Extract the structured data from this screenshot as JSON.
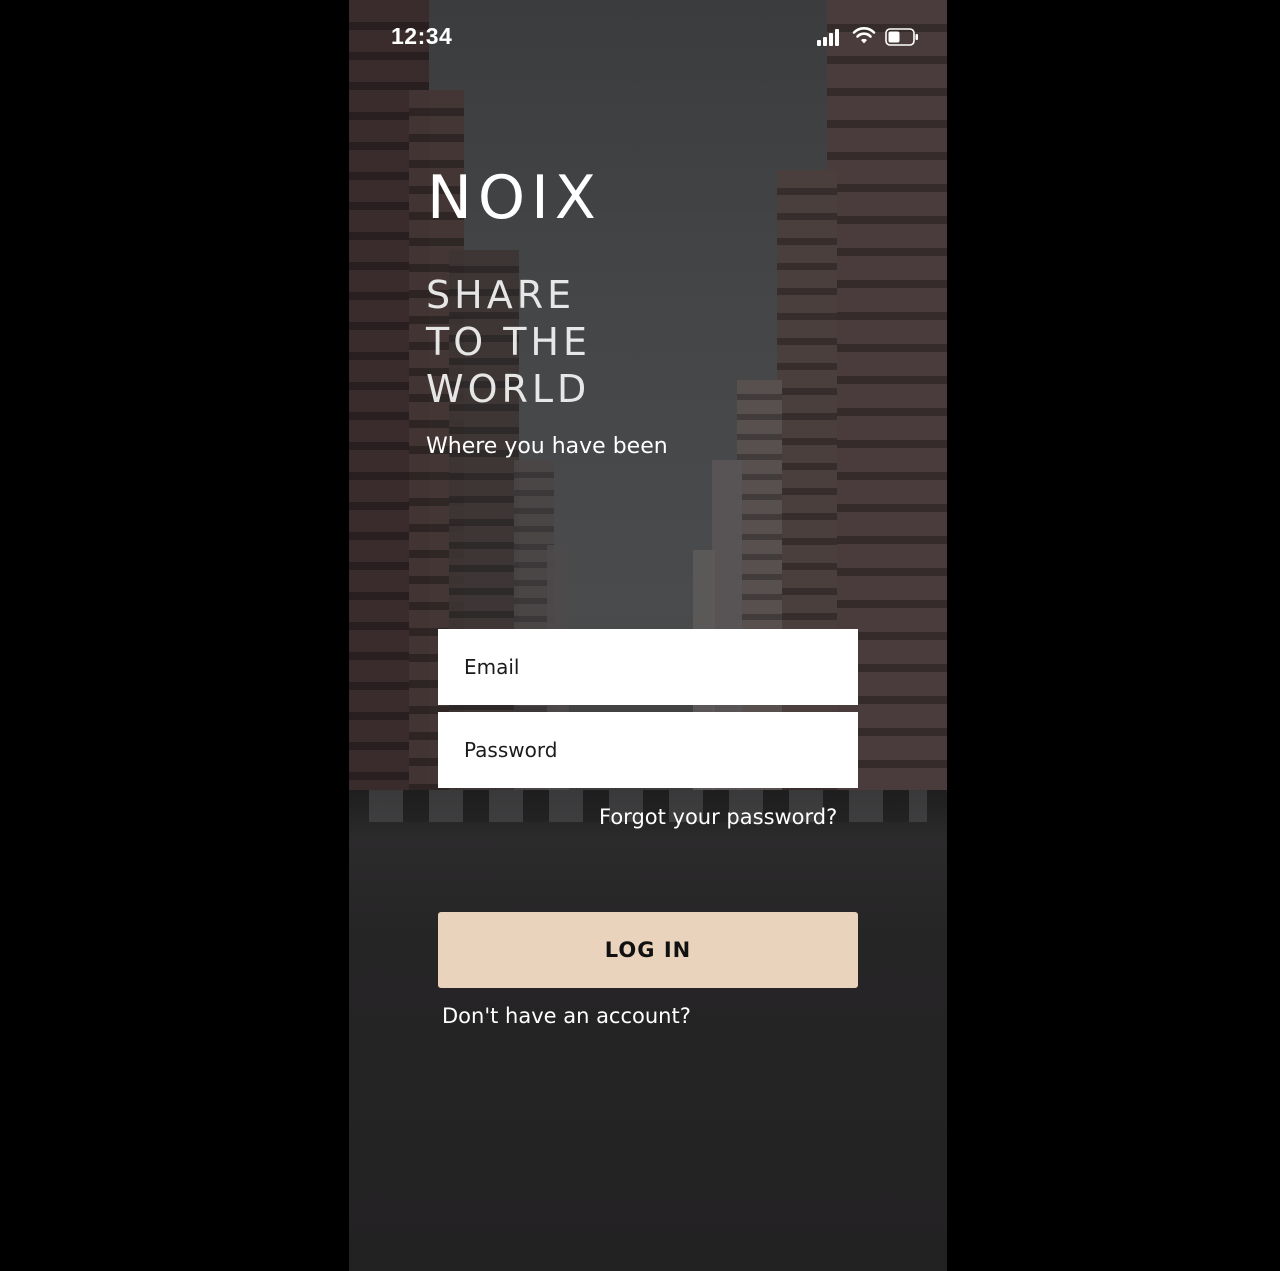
{
  "status_bar": {
    "time": "12:34",
    "signal_icon": "cellular-signal-icon",
    "wifi_icon": "wifi-icon",
    "battery_icon": "battery-icon"
  },
  "hero": {
    "brand": "NOIX",
    "tagline_lines": [
      "SHARE",
      "TO THE",
      "WORLD"
    ],
    "subtitle": "Where you have been"
  },
  "form": {
    "email_placeholder": "Email",
    "password_placeholder": "Password",
    "forgot_label": "Forgot your password?",
    "login_label": "LOG IN",
    "signup_label": "Don't have an account?"
  },
  "colors": {
    "login_button": "#ead3bd",
    "field_background": "#ffffff",
    "text_light": "#ffffff"
  }
}
